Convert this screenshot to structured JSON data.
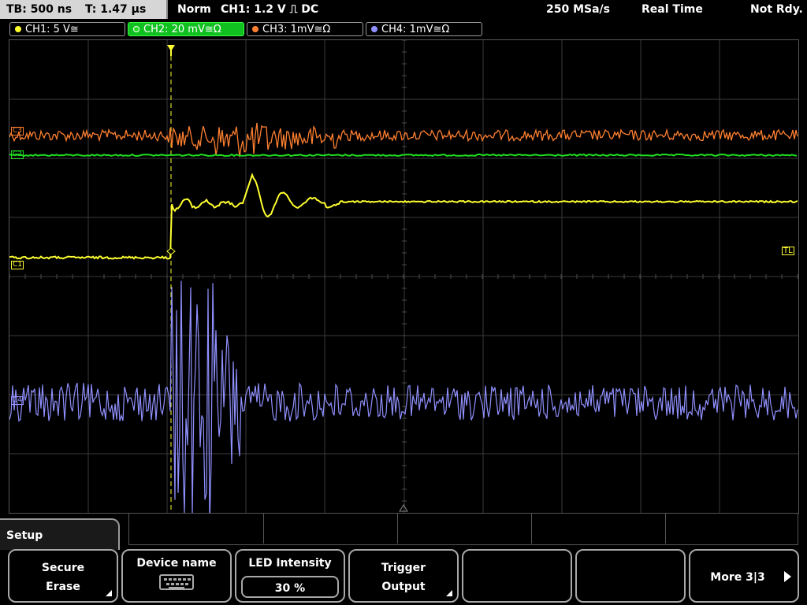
{
  "status_bar": {
    "timebase": "TB: 500 ns",
    "trigger_time": "T: 1.47 µs",
    "acq_mode": "Norm",
    "trigger_info": "CH1: 1.2 V ⎍ DC",
    "sample_rate": "250 MSa/s",
    "realtime": "Real Time",
    "ready_state": "Not Rdy."
  },
  "channels": [
    {
      "label": "CH1: 5 V≅",
      "color": "#ffff30",
      "active": false
    },
    {
      "label": "CH2: 20 mV≅Ω",
      "color": "#20e020",
      "active": true
    },
    {
      "label": "CH3: 1mV≅Ω",
      "color": "#ff8030",
      "active": false
    },
    {
      "label": "CH4: 1mV≅Ω",
      "color": "#9090ff",
      "active": false
    }
  ],
  "markers": {
    "c3": "C3",
    "c2": "C2",
    "c1": "C1",
    "c4": "C4",
    "trigger_level": "TL"
  },
  "menu": {
    "title": "Setup",
    "softkeys": [
      {
        "line1": "Secure",
        "line2": "Erase",
        "has_submenu": true
      },
      {
        "line1": "Device name",
        "icon": "keyboard-icon"
      },
      {
        "line1": "LED Intensity",
        "value": "30 %"
      },
      {
        "line1": "Trigger",
        "line2": "Output",
        "has_submenu": true
      },
      {
        "line1": ""
      },
      {
        "line1": ""
      },
      {
        "line1": "More 3|3"
      }
    ]
  }
}
